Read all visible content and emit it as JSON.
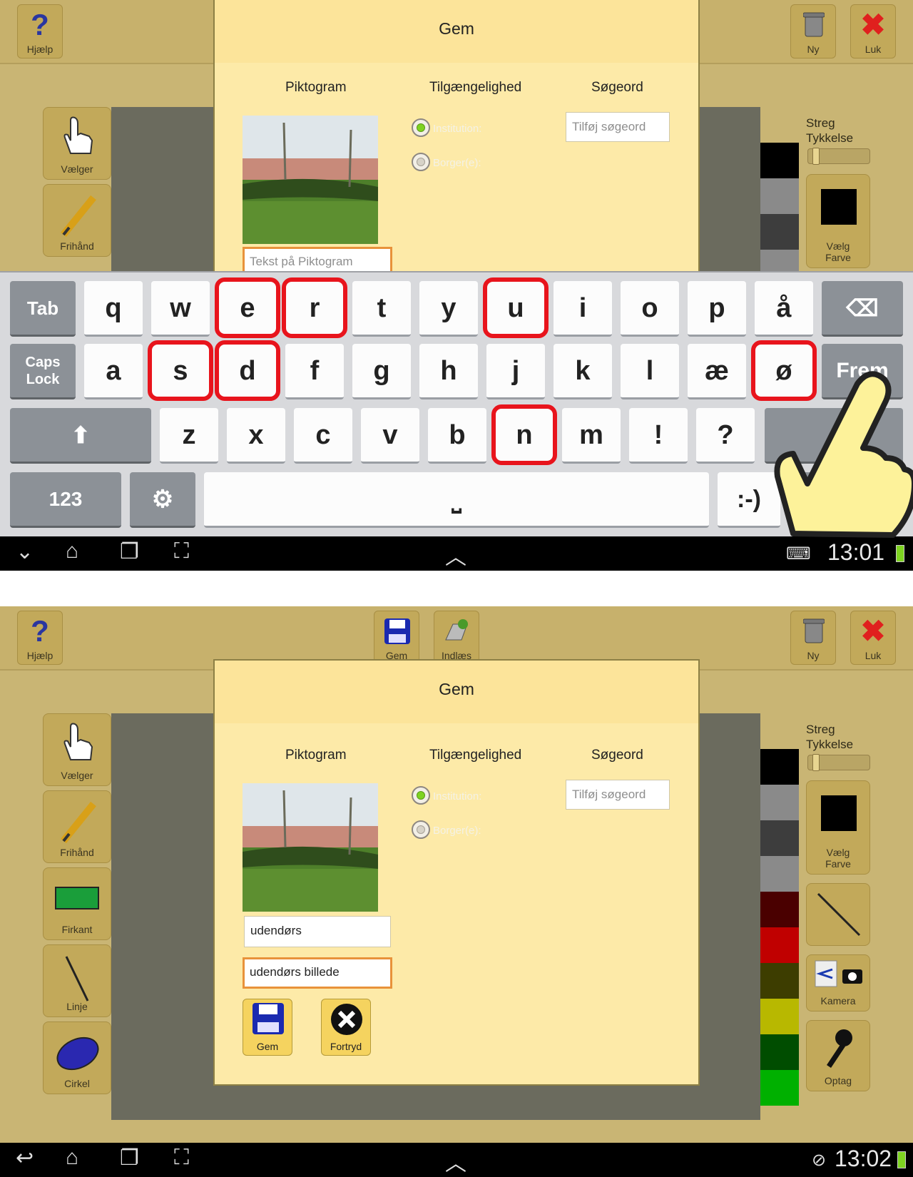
{
  "toolbar": {
    "help": "Hjælp",
    "new": "Ny",
    "close": "Luk",
    "save": "Gem",
    "load": "Indlæs"
  },
  "tools": {
    "select": "Vælger",
    "freehand": "Frihånd",
    "rect": "Firkant",
    "line": "Linje",
    "circle": "Cirkel"
  },
  "right_panel": {
    "stroke_label_1": "Streg",
    "stroke_label_2": "Tykkelse",
    "color_label_1": "Vælg",
    "color_label_2": "Farve",
    "camera": "Kamera",
    "record": "Optag"
  },
  "dialog": {
    "title": "Gem",
    "col_pictogram": "Piktogram",
    "col_access": "Tilgængelighed",
    "col_keywords": "Søgeord",
    "radio_institution": "Institution:",
    "radio_citizen": "Borger(e):",
    "keyword_placeholder": "Tilføj søgeord",
    "text_placeholder": "Tekst på Piktogram",
    "name_value": "udendørs",
    "text_value": "udendørs billede",
    "save_label": "Gem",
    "cancel_label": "Fortryd"
  },
  "keyboard": {
    "row1": [
      "q",
      "w",
      "e",
      "r",
      "t",
      "y",
      "u",
      "i",
      "o",
      "p",
      "å"
    ],
    "row2": [
      "a",
      "s",
      "d",
      "f",
      "g",
      "h",
      "j",
      "k",
      "l",
      "æ",
      "ø"
    ],
    "row3": [
      "z",
      "x",
      "c",
      "v",
      "b",
      "n",
      "m",
      "!",
      "?"
    ],
    "tab": "Tab",
    "caps": "Caps Lock",
    "next": "Frem",
    "num": "123",
    "smiley": ":-)",
    "highlighted": [
      "e",
      "r",
      "u",
      "s",
      "d",
      "ø",
      "n"
    ]
  },
  "status": {
    "time_top": "13:01",
    "time_bottom": "13:02"
  },
  "colors": {
    "app_bg": "#c9b574",
    "dialog_bg": "#fdeaa8",
    "highlight": "#e8141c",
    "focus": "#e8923a"
  }
}
